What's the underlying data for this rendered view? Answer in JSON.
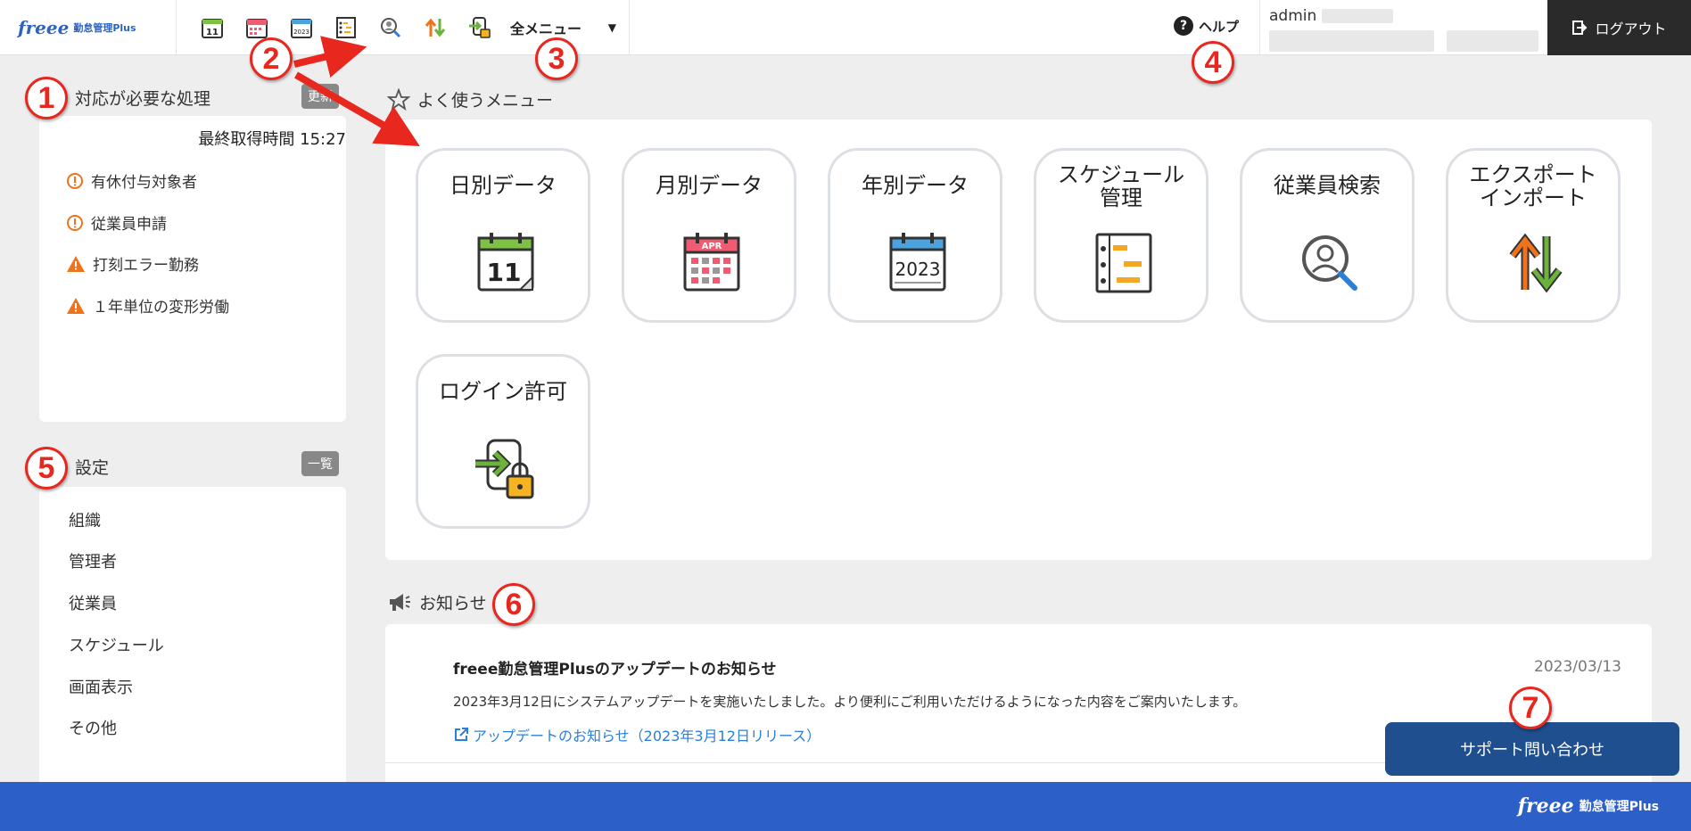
{
  "header": {
    "logo_text": "freee",
    "logo_sub": "勤怠管理Plus",
    "toolbar_icons": [
      "daily-calendar-icon",
      "monthly-calendar-icon",
      "yearly-calendar-icon",
      "schedule-icon",
      "employee-search-icon",
      "export-import-icon",
      "login-permission-icon"
    ],
    "all_menu_label": "全メニュー",
    "help_label": "ヘルプ",
    "user_name": "admin",
    "logout_label": "ログアウト"
  },
  "alerts": {
    "title": "対応が必要な処理",
    "refresh_label": "更新",
    "last_fetch": "最終取得時間 15:27",
    "items": [
      {
        "label": "有休付与対象者",
        "type": "info"
      },
      {
        "label": "従業員申請",
        "type": "info"
      },
      {
        "label": "打刻エラー勤務",
        "type": "warning"
      },
      {
        "label": "１年単位の変形労働",
        "type": "warning"
      }
    ]
  },
  "settings": {
    "title": "設定",
    "list_label": "一覧",
    "items": [
      "組織",
      "管理者",
      "従業員",
      "スケジュール",
      "画面表示",
      "その他"
    ]
  },
  "favorites": {
    "title": "よく使うメニュー",
    "tiles": [
      {
        "label": "日別データ",
        "icon": "daily-calendar-icon"
      },
      {
        "label": "月別データ",
        "icon": "monthly-calendar-icon",
        "icon_text": "APR"
      },
      {
        "label": "年別データ",
        "icon": "yearly-calendar-icon",
        "icon_text": "2023"
      },
      {
        "label": "スケジュール\n管理",
        "icon": "schedule-icon"
      },
      {
        "label": "従業員検索",
        "icon": "employee-search-icon"
      },
      {
        "label": "エクスポート\nインポート",
        "icon": "export-import-icon"
      },
      {
        "label": "ログイン許可",
        "icon": "login-permission-icon"
      }
    ]
  },
  "news": {
    "title": "お知らせ",
    "item_title": "freee勤怠管理Plusのアップデートのお知らせ",
    "item_date": "2023/03/13",
    "item_body": "2023年3月12日にシステムアップデートを実施いたしました。より便利にご利用いただけるようになった内容をご案内いたします。",
    "item_link": "アップデートのお知らせ（2023年3月12日リリース）"
  },
  "support_label": "サポート問い合わせ",
  "footer": {
    "logo_text": "freee",
    "logo_sub": "勤怠管理Plus"
  },
  "annotations": [
    "1",
    "2",
    "3",
    "4",
    "5",
    "6",
    "7"
  ],
  "colors": {
    "accent": "#2d5fc8",
    "support": "#1f4f8f",
    "annotation": "#e8271f",
    "link": "#2b7fd8"
  }
}
